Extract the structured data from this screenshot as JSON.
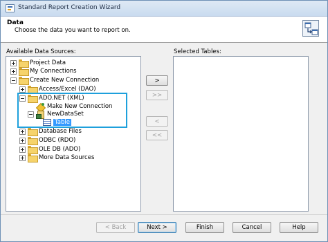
{
  "window": {
    "title": "Standard Report Creation Wizard"
  },
  "header": {
    "title": "Data",
    "subtitle": "Choose the data you want to report on."
  },
  "available": {
    "label": "Available Data Sources:",
    "tree": [
      {
        "label": "Project Data"
      },
      {
        "label": "My Connections"
      },
      {
        "label": "Create New Connection"
      },
      {
        "label": "Access/Excel (DAO)"
      },
      {
        "label": "ADO.NET (XML)"
      },
      {
        "label": "Make New Connection"
      },
      {
        "label": "NewDataSet"
      },
      {
        "label": "Table"
      },
      {
        "label": "Database Files"
      },
      {
        "label": "ODBC (RDO)"
      },
      {
        "label": "OLE DB (ADO)"
      },
      {
        "label": "More Data Sources"
      }
    ]
  },
  "selected": {
    "label": "Selected Tables:"
  },
  "transfer_buttons": {
    "add": ">",
    "add_all": ">>",
    "remove": "<",
    "remove_all": "<<"
  },
  "footer_buttons": {
    "back": "< Back",
    "next": "Next >",
    "finish": "Finish",
    "cancel": "Cancel",
    "help": "Help"
  },
  "colors": {
    "selection": "#3399ff",
    "callout": "#1ea0dc"
  }
}
